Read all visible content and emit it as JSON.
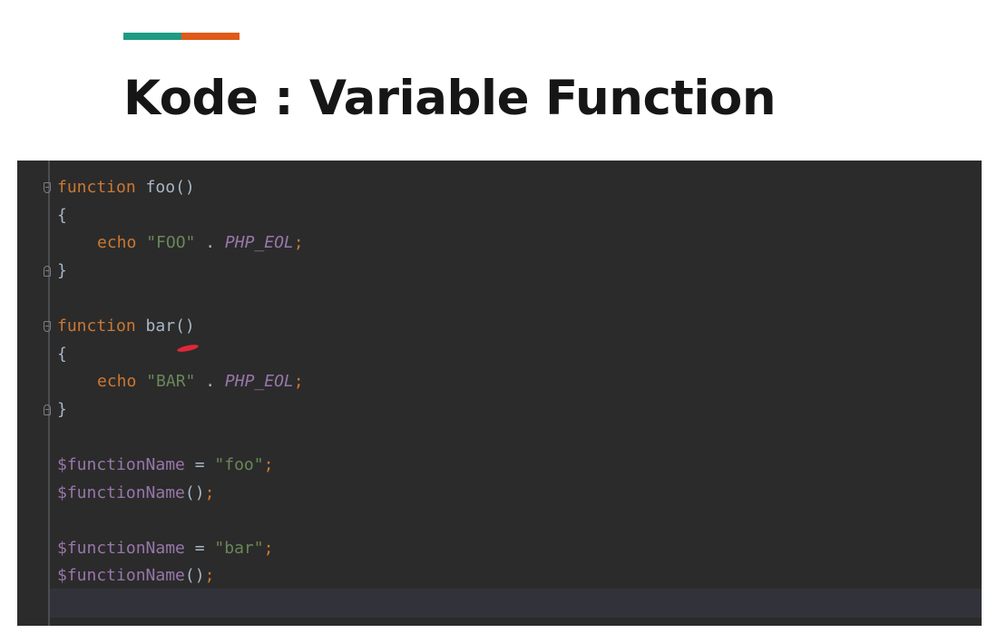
{
  "slide": {
    "title": "Kode : Variable Function",
    "accent_colors": [
      "#1f9b82",
      "#e05a18"
    ],
    "title_color": "#161616"
  },
  "editor": {
    "background": "#2b2b2b",
    "gutter_line_color": "#4b4d50",
    "current_line_color": "#32333a",
    "cursor_color": "#e0273a",
    "colors": {
      "keyword": "#cc7832",
      "plain": "#a9b7c6",
      "function_name": "#a9b7c6",
      "string": "#6a8759",
      "constant": "#9876aa",
      "variable": "#9876aa"
    },
    "lines": [
      {
        "fold": "start",
        "tokens": [
          {
            "t": "function",
            "c": "keyword"
          },
          {
            "t": " ",
            "c": "plain"
          },
          {
            "t": "foo",
            "c": "function_name"
          },
          {
            "t": "()",
            "c": "plain"
          }
        ]
      },
      {
        "tokens": [
          {
            "t": "{",
            "c": "plain"
          }
        ]
      },
      {
        "indent": 1,
        "tokens": [
          {
            "t": "echo",
            "c": "keyword"
          },
          {
            "t": " ",
            "c": "plain"
          },
          {
            "t": "\"FOO\"",
            "c": "string"
          },
          {
            "t": " . ",
            "c": "plain"
          },
          {
            "t": "PHP_EOL",
            "c": "constant",
            "italic": true
          },
          {
            "t": ";",
            "c": "keyword"
          }
        ]
      },
      {
        "fold": "end",
        "tokens": [
          {
            "t": "}",
            "c": "plain"
          }
        ]
      },
      {
        "tokens": []
      },
      {
        "fold": "start",
        "tokens": [
          {
            "t": "function",
            "c": "keyword"
          },
          {
            "t": " ",
            "c": "plain"
          },
          {
            "t": "bar",
            "c": "function_name"
          },
          {
            "t": "()",
            "c": "plain"
          }
        ]
      },
      {
        "tokens": [
          {
            "t": "{",
            "c": "plain"
          }
        ]
      },
      {
        "indent": 1,
        "tokens": [
          {
            "t": "echo",
            "c": "keyword"
          },
          {
            "t": " ",
            "c": "plain"
          },
          {
            "t": "\"BAR\"",
            "c": "string"
          },
          {
            "t": " . ",
            "c": "plain"
          },
          {
            "t": "PHP_EOL",
            "c": "constant",
            "italic": true
          },
          {
            "t": ";",
            "c": "keyword"
          }
        ]
      },
      {
        "fold": "end",
        "tokens": [
          {
            "t": "}",
            "c": "plain"
          }
        ]
      },
      {
        "tokens": []
      },
      {
        "tokens": [
          {
            "t": "$functionName",
            "c": "variable"
          },
          {
            "t": " = ",
            "c": "plain"
          },
          {
            "t": "\"foo\"",
            "c": "string"
          },
          {
            "t": ";",
            "c": "keyword"
          }
        ]
      },
      {
        "tokens": [
          {
            "t": "$functionName",
            "c": "variable"
          },
          {
            "t": "()",
            "c": "plain"
          },
          {
            "t": ";",
            "c": "keyword"
          }
        ]
      },
      {
        "tokens": []
      },
      {
        "tokens": [
          {
            "t": "$functionName",
            "c": "variable"
          },
          {
            "t": " = ",
            "c": "plain"
          },
          {
            "t": "\"bar\"",
            "c": "string"
          },
          {
            "t": ";",
            "c": "keyword"
          }
        ]
      },
      {
        "tokens": [
          {
            "t": "$functionName",
            "c": "variable"
          },
          {
            "t": "()",
            "c": "plain"
          },
          {
            "t": ";",
            "c": "keyword"
          }
        ]
      }
    ]
  }
}
